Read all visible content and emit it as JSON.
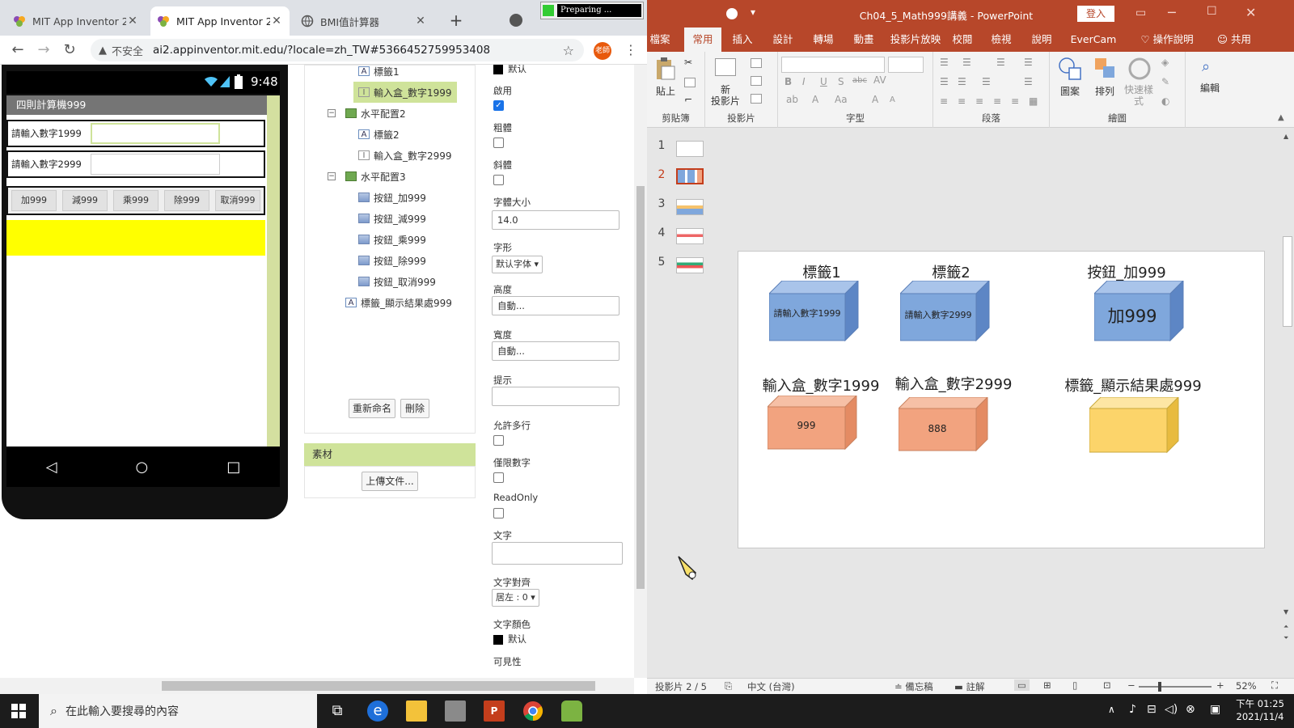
{
  "browser": {
    "tabs": [
      {
        "title": "MIT App Inventor 2"
      },
      {
        "title": "MIT App Inventor 2"
      },
      {
        "title": "BMI值計算器"
      }
    ],
    "download_status": "Preparing ...",
    "insecure_label": "不安全",
    "url": "ai2.appinventor.mit.edu/?locale=zh_TW#5366452759953408",
    "profile_label": "老師"
  },
  "phone": {
    "time": "9:48",
    "app_title": "四則計算機999",
    "row1_label": "請輸入數字1999",
    "row2_label": "請輸入數字2999",
    "buttons": [
      "加999",
      "減999",
      "乘999",
      "除999",
      "取消999"
    ]
  },
  "components": {
    "items": [
      {
        "label": "標籤1"
      },
      {
        "label": "輸入盒_數字1999"
      },
      {
        "label": "水平配置2"
      },
      {
        "label": "標籤2"
      },
      {
        "label": "輸入盒_數字2999"
      },
      {
        "label": "水平配置3"
      },
      {
        "label": "按鈕_加999"
      },
      {
        "label": "按鈕_減999"
      },
      {
        "label": "按鈕_乘999"
      },
      {
        "label": "按鈕_除999"
      },
      {
        "label": "按鈕_取消999"
      },
      {
        "label": "標籤_顯示結果處999"
      }
    ],
    "rename_label": "重新命名",
    "delete_label": "刪除",
    "assets_header": "素材",
    "upload_label": "上傳文件..."
  },
  "properties": {
    "bgcolor_value": "默认",
    "enabled_label": "啟用",
    "bold_label": "粗體",
    "italic_label": "斜體",
    "fontsize_label": "字體大小",
    "fontsize_value": "14.0",
    "fontface_label": "字形",
    "fontface_value": "默认字体",
    "height_label": "高度",
    "height_value": "自動...",
    "width_label": "寬度",
    "width_value": "自動...",
    "hint_label": "提示",
    "multiline_label": "允許多行",
    "numbers_only_label": "僅限數字",
    "readonly_label": "ReadOnly",
    "text_label": "文字",
    "align_label": "文字對齊",
    "align_value": "居左 : 0",
    "textcolor_label": "文字顏色",
    "textcolor_value": "默认",
    "visible_label": "可見性"
  },
  "powerpoint": {
    "title": "Ch04_5_Math999講義 - PowerPoint",
    "signin_label": "登入",
    "tabs": [
      "檔案",
      "常用",
      "插入",
      "設計",
      "轉場",
      "動畫",
      "投影片放映",
      "校閱",
      "檢視",
      "說明",
      "EverCam",
      "操作說明",
      "共用"
    ],
    "groups": {
      "clipboard": "剪貼簿",
      "slides": "投影片",
      "font": "字型",
      "paragraph": "段落",
      "drawing": "繪圖",
      "paste": "貼上",
      "new_slide": "新\n投影片",
      "shapes": "圖案",
      "arrange": "排列",
      "quick_styles": "快速樣\n式",
      "editing": "編輯"
    },
    "slide_numbers": [
      "1",
      "2",
      "3",
      "4",
      "5"
    ],
    "slide": {
      "captions": [
        "標籤1",
        "標籤2",
        "按鈕_加999",
        "輸入盒_數字1999",
        "輸入盒_數字2999",
        "標籤_顯示結果處999"
      ],
      "cube_texts": [
        "請輸入數字1999",
        "請輸入數字2999",
        "加999",
        "999",
        "888",
        ""
      ]
    },
    "status": {
      "slide_indicator": "投影片 2 / 5",
      "language": "中文 (台灣)",
      "notes": "備忘稿",
      "comments": "註解",
      "zoom": "52%"
    },
    "colors": {
      "accent": "#b7472a",
      "blue_cube": "#7fa7dc",
      "orange_cube": "#f2a37f",
      "yellow_cube": "#fcd46a"
    }
  },
  "taskbar": {
    "search_placeholder": "在此輸入要搜尋的內容",
    "time": "下午 01:25",
    "date": "2021/11/4"
  }
}
